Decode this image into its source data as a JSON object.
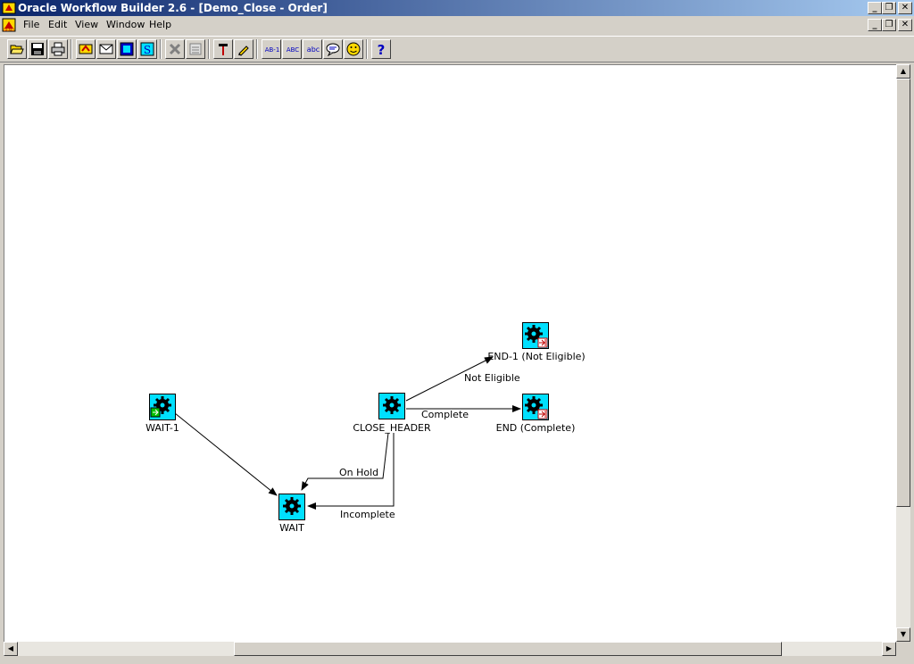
{
  "window": {
    "title": "Oracle Workflow Builder 2.6 - [Demo_Close - Order]"
  },
  "menu": {
    "items": [
      "File",
      "Edit",
      "View",
      "Window",
      "Help"
    ]
  },
  "toolbar": {
    "buttons": [
      "open-icon",
      "save-icon",
      "print-icon",
      "new-item-icon",
      "message-icon",
      "notification-icon",
      "function-icon",
      "delete-icon",
      "properties-icon",
      "hammer-icon",
      "pencil-icon",
      "label-ab1-icon",
      "label-upper-abc-icon",
      "label-lower-abc-icon",
      "comment-bubble-icon",
      "smiley-icon",
      "help-icon"
    ],
    "text_buttons": {
      "ab1": "AB-1",
      "upper_abc": "ABC",
      "lower_abc": "abc",
      "help": "?"
    }
  },
  "diagram": {
    "nodes": {
      "wait1": "WAIT-1",
      "wait": "WAIT",
      "close_header": "CLOSE_HEADER",
      "end1": "END-1 (Not Eligible)",
      "end": "END (Complete)"
    },
    "edges": {
      "not_eligible": "Not Eligible",
      "complete": "Complete",
      "on_hold": "On Hold",
      "incomplete": "Incomplete"
    }
  },
  "colors": {
    "title_gradient_start": "#0a246a",
    "title_gradient_end": "#a6caf0",
    "node_fill": "#00e0ff",
    "chrome": "#d4d0c8"
  }
}
